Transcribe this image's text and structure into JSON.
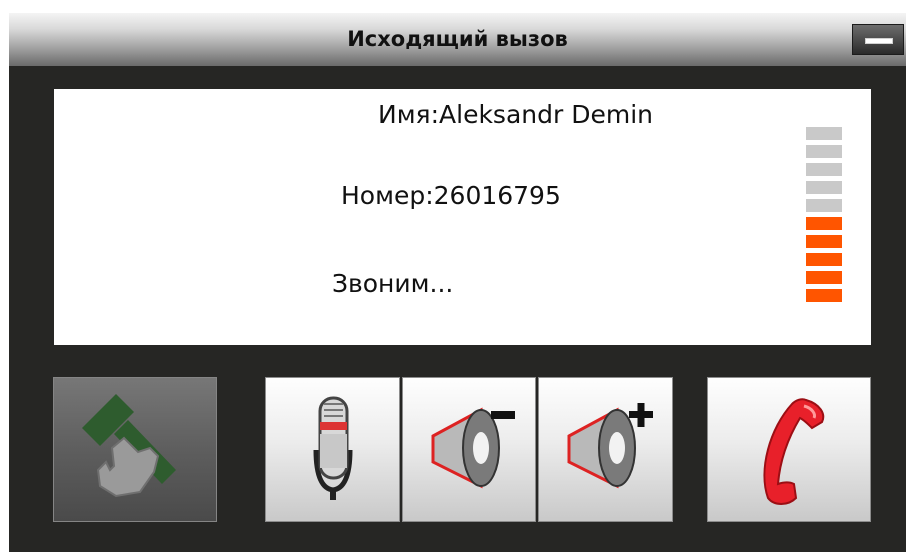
{
  "window": {
    "title": "Исходящий вызов",
    "minimize_icon": "minimize-icon"
  },
  "call": {
    "name_line": "Имя:Aleksandr Demin",
    "number_line": "Номер:26016795",
    "status": "Звоним..."
  },
  "signal_level": {
    "total_segments": 10,
    "active_segments": 5,
    "active_color": "#ff5500",
    "inactive_color": "#c9c9c9"
  },
  "buttons": [
    {
      "id": "transfer",
      "icon": "call-transfer-icon"
    },
    {
      "id": "microphone",
      "icon": "microphone-icon"
    },
    {
      "id": "volume-down",
      "icon": "speaker-minus-icon"
    },
    {
      "id": "volume-up",
      "icon": "speaker-plus-icon"
    },
    {
      "id": "hang-up",
      "icon": "phone-handset-red-icon"
    }
  ],
  "colors": {
    "background": "#262624",
    "hangup_red": "#e8202a",
    "transfer_green": "#2f5e2f"
  }
}
